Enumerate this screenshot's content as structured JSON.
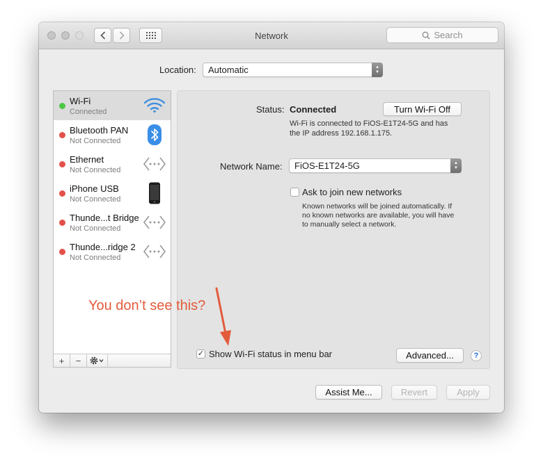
{
  "window": {
    "title": "Network"
  },
  "toolbar": {
    "search_placeholder": "Search"
  },
  "location": {
    "label": "Location:",
    "value": "Automatic"
  },
  "services": [
    {
      "name": "Wi-Fi",
      "status": "Connected",
      "color": "#4cc742",
      "icon": "wifi-icon"
    },
    {
      "name": "Bluetooth PAN",
      "status": "Not Connected",
      "color": "#e2504a",
      "icon": "bluetooth-icon"
    },
    {
      "name": "Ethernet",
      "status": "Not Connected",
      "color": "#e2504a",
      "icon": "ethernet-icon"
    },
    {
      "name": "iPhone USB",
      "status": "Not Connected",
      "color": "#e2504a",
      "icon": "iphone-icon"
    },
    {
      "name": "Thunde...t Bridge",
      "status": "Not Connected",
      "color": "#e2504a",
      "icon": "thunderbolt-bridge-icon"
    },
    {
      "name": "Thunde...ridge 2",
      "status": "Not Connected",
      "color": "#e2504a",
      "icon": "thunderbolt-bridge-icon"
    }
  ],
  "sidebar_tools": {
    "add": "+",
    "remove": "−"
  },
  "detail": {
    "status_label": "Status:",
    "status_value": "Connected",
    "turn_off_button": "Turn Wi-Fi Off",
    "status_desc_line1": "Wi-Fi is connected to FiOS-E1T24-5G and has",
    "status_desc_line2": "the IP address 192.168.1.175.",
    "network_name_label": "Network Name:",
    "network_name_value": "FiOS-E1T24-5G",
    "ask_join_label": "Ask to join new networks",
    "ask_join_desc_line1": "Known networks will be joined automatically. If",
    "ask_join_desc_line2": "no known networks are available, you will have",
    "ask_join_desc_line3": "to manually select a network.",
    "show_status_label": "Show Wi-Fi status in menu bar",
    "advanced_button": "Advanced...",
    "help_label": "?"
  },
  "footer": {
    "assist_button": "Assist Me...",
    "revert_button": "Revert",
    "apply_button": "Apply"
  },
  "annotation": {
    "text": "You don’t see this?",
    "color": "#e25b3b"
  }
}
